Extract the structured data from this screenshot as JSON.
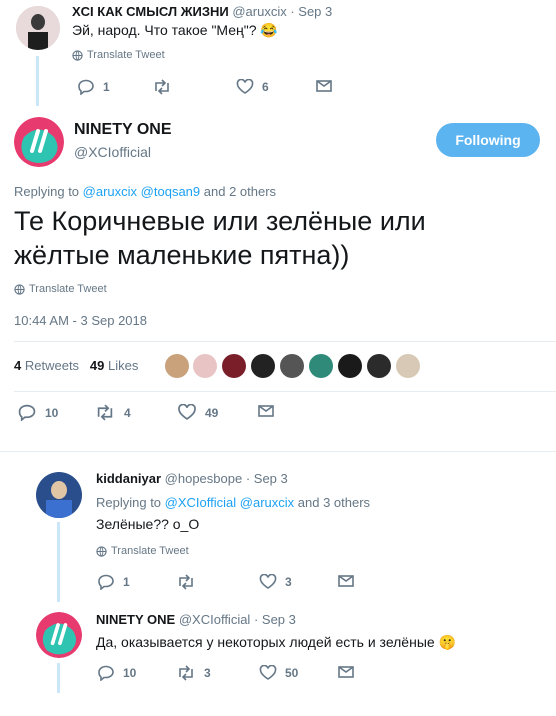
{
  "tweet1": {
    "name": "XCI КАК СМЫСЛ ЖИЗНИ",
    "handle": "@aruxcix",
    "date": "· Sep 3",
    "text": "Эй, народ. Что такое \"Мең\"? 😂",
    "translate": "Translate Tweet",
    "replies": "1",
    "retweets": "",
    "likes": "6"
  },
  "main_tweet": {
    "name": "NINETY ONE",
    "handle": "@XCIofficial",
    "follow_label": "Following",
    "replying_prefix": "Replying to",
    "replying_user1": "@aruxcix",
    "replying_user2": "@toqsan9",
    "replying_suffix": "and 2 others",
    "text_line1": "Те Коричневые или зелёные или",
    "text_line2": "жёлтые маленькие пятна))",
    "translate": "Translate Tweet",
    "timestamp": "10:44 AM - 3 Sep 2018",
    "retweets_count": "4",
    "retweets_label": "Retweets",
    "likes_count": "49",
    "likes_label": "Likes",
    "replies": "10",
    "retweets": "4",
    "likes": "49"
  },
  "reply1": {
    "name": "kiddaniyar",
    "handle": "@hopesbope",
    "date": "· Sep 3",
    "replying_prefix": "Replying to",
    "replying_user1": "@XCIofficial",
    "replying_user2": "@aruxcix",
    "replying_suffix": "and 3 others",
    "text": "Зелёные?? о_О",
    "translate": "Translate Tweet",
    "replies": "1",
    "retweets": "",
    "likes": "3"
  },
  "reply2": {
    "name": "NINETY ONE",
    "handle": "@XCIofficial",
    "date": "· Sep 3",
    "text": "Да, оказывается у некоторых людей есть и зелёные 🤫",
    "replies": "10",
    "retweets": "3",
    "likes": "50"
  },
  "colors": {
    "accent": "#1da1f2",
    "follow_button": "#5bb3f0",
    "muted": "#657786",
    "thread_line": "#cbe6f8"
  }
}
